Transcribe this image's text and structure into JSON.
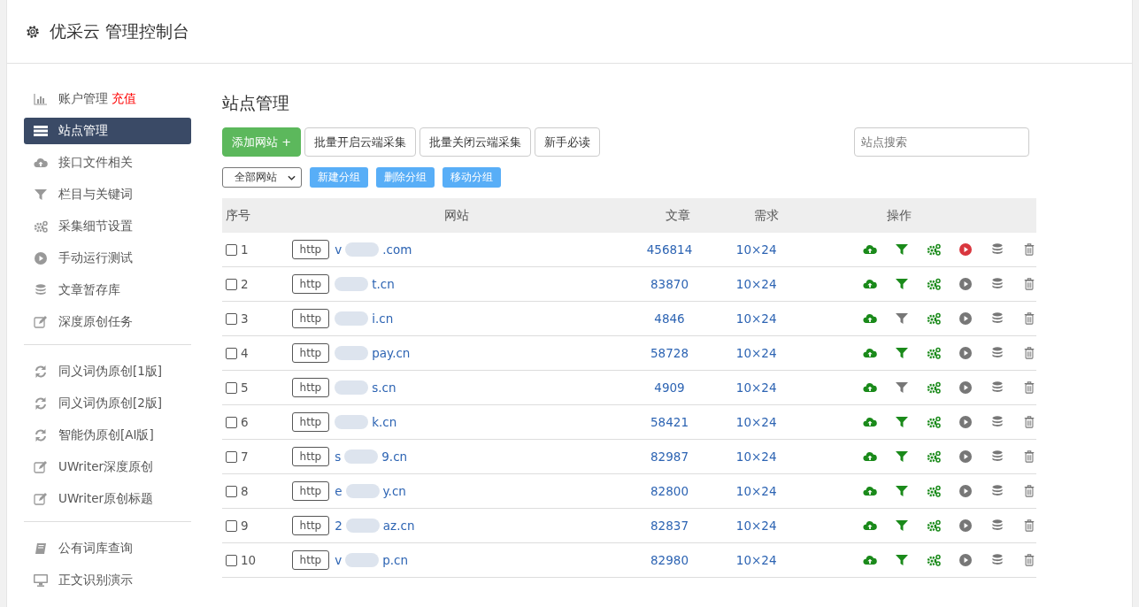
{
  "header": {
    "title": "优采云 管理控制台"
  },
  "sidebar": {
    "groups": [
      [
        {
          "kind": "chart",
          "label": "账户管理",
          "badge": "充值",
          "selected": false
        },
        {
          "kind": "list",
          "label": "站点管理",
          "selected": true
        },
        {
          "kind": "cloud",
          "label": "接口文件相关",
          "selected": false
        },
        {
          "kind": "filter",
          "label": "栏目与关键词",
          "selected": false
        },
        {
          "kind": "gears",
          "label": "采集细节设置",
          "selected": false
        },
        {
          "kind": "play",
          "label": "手动运行测试",
          "selected": false
        },
        {
          "kind": "db",
          "label": "文章暂存库",
          "selected": false
        },
        {
          "kind": "edit",
          "label": "深度原创任务",
          "selected": false
        }
      ],
      [
        {
          "kind": "refresh",
          "label": "同义词伪原创[1版]",
          "selected": false
        },
        {
          "kind": "refresh",
          "label": "同义词伪原创[2版]",
          "selected": false
        },
        {
          "kind": "refresh",
          "label": "智能伪原创[AI版]",
          "selected": false
        },
        {
          "kind": "edit",
          "label": "UWriter深度原创",
          "selected": false
        },
        {
          "kind": "edit",
          "label": "UWriter原创标题",
          "selected": false
        }
      ],
      [
        {
          "kind": "book",
          "label": "公有词库查询",
          "selected": false
        },
        {
          "kind": "monitor",
          "label": "正文识别演示",
          "selected": false
        }
      ]
    ]
  },
  "page_title": "站点管理",
  "toolbar": {
    "buttons": [
      {
        "label": "添加网站 +",
        "kind": "primary"
      },
      {
        "label": "批量开启云端采集",
        "kind": "default"
      },
      {
        "label": "批量关闭云端采集",
        "kind": "default"
      },
      {
        "label": "新手必读",
        "kind": "default"
      }
    ],
    "search": {
      "placeholder": "站点搜索"
    }
  },
  "group_bar": {
    "select": "全部网站",
    "buttons": [
      "新建分组",
      "删除分组",
      "移动分组"
    ]
  },
  "table": {
    "columns": [
      "序号",
      "网站",
      "文章",
      "需求",
      "操作"
    ],
    "rows": [
      {
        "checked": false,
        "index": "1",
        "protocol": "http",
        "domain_start": "v",
        "domain_end": ".com",
        "articles": "456814",
        "demand": "10×24",
        "filter_on": true,
        "running": true
      },
      {
        "checked": false,
        "index": "2",
        "protocol": "http",
        "domain_end": "t.cn",
        "articles": "83870",
        "demand": "10×24",
        "filter_on": true,
        "running": false
      },
      {
        "checked": false,
        "index": "3",
        "protocol": "http",
        "domain_end": "i.cn",
        "articles": "4846",
        "demand": "10×24",
        "filter_on": false,
        "running": false
      },
      {
        "checked": false,
        "index": "4",
        "protocol": "http",
        "domain_end": "pay.cn",
        "articles": "58728",
        "demand": "10×24",
        "filter_on": true,
        "running": false
      },
      {
        "checked": false,
        "index": "5",
        "protocol": "http",
        "domain_end": "s.cn",
        "articles": "4909",
        "demand": "10×24",
        "filter_on": false,
        "running": false
      },
      {
        "checked": false,
        "index": "6",
        "protocol": "http",
        "domain_end": "k.cn",
        "articles": "58421",
        "demand": "10×24",
        "filter_on": true,
        "running": false
      },
      {
        "checked": false,
        "index": "7",
        "protocol": "http",
        "domain_start": "s",
        "domain_end": "9.cn",
        "articles": "82987",
        "demand": "10×24",
        "filter_on": true,
        "running": false
      },
      {
        "checked": false,
        "index": "8",
        "protocol": "http",
        "domain_start": "e",
        "domain_end": "y.cn",
        "articles": "82800",
        "demand": "10×24",
        "filter_on": true,
        "running": false
      },
      {
        "checked": false,
        "index": "9",
        "protocol": "http",
        "domain_start": "2",
        "domain_end": "az.cn",
        "articles": "82837",
        "demand": "10×24",
        "filter_on": true,
        "running": false
      },
      {
        "checked": false,
        "index": "10",
        "protocol": "http",
        "domain_start": "v",
        "domain_end": "p.cn",
        "articles": "82980",
        "demand": "10×24",
        "filter_on": true,
        "running": false
      }
    ]
  }
}
